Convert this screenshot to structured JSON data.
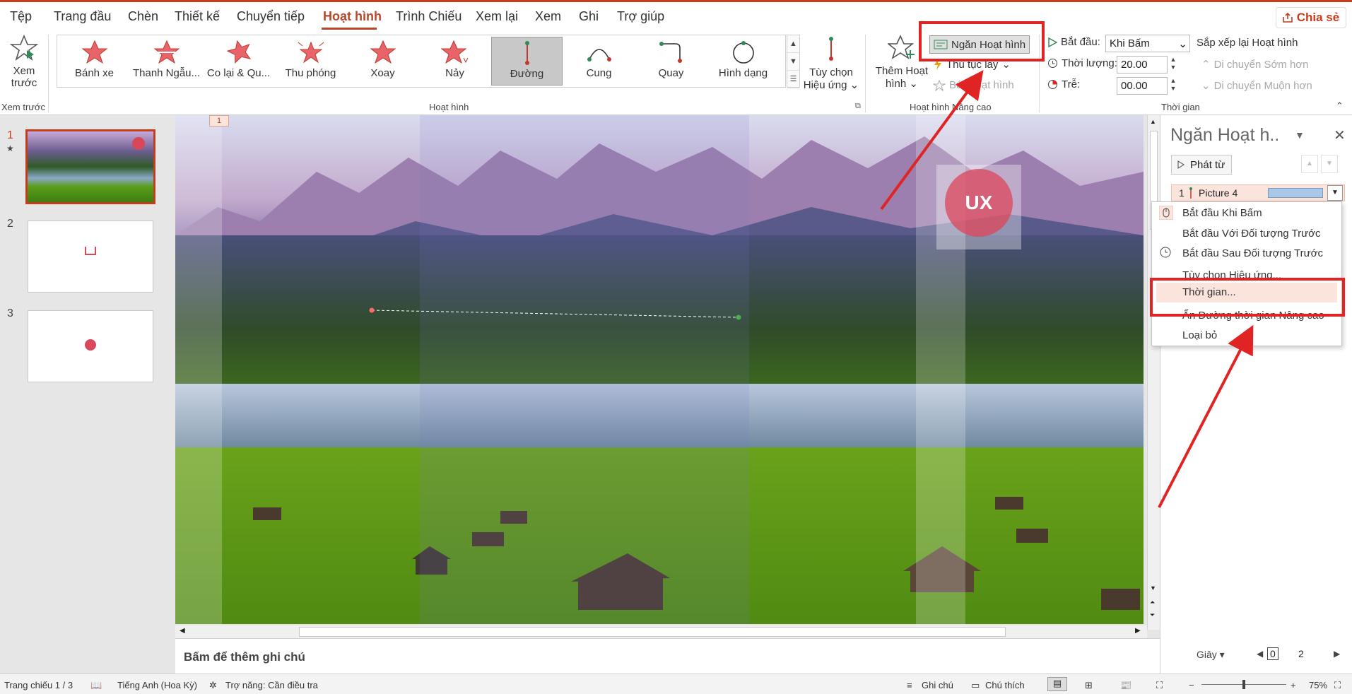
{
  "tabs": [
    "Tệp",
    "Trang đầu",
    "Chèn",
    "Thiết kế",
    "Chuyển tiếp",
    "Hoạt hình",
    "Trình Chiếu",
    "Xem lại",
    "Xem",
    "Ghi",
    "Trợ giúp"
  ],
  "share_label": "Chia sẻ",
  "ribbon": {
    "preview": {
      "label_line1": "Xem",
      "label_line2": "trước",
      "group_label": "Xem trước"
    },
    "gallery": {
      "items": [
        "Bánh xe",
        "Thanh Ngẫu...",
        "Co lại & Qu...",
        "Thu phóng",
        "Xoay",
        "Nảy",
        "Đường",
        "Cung",
        "Quay",
        "Hình dạng"
      ],
      "selected": "Đường",
      "group_label": "Hoạt hình"
    },
    "effect_options": {
      "line1": "Tùy chọn",
      "line2": "Hiệu ứng"
    },
    "advanced": {
      "add_line1": "Thêm Hoạt",
      "add_line2": "hình",
      "pane_button": "Ngăn Hoạt hình",
      "trigger": "Thủ tục lẫy",
      "painter": "Bút Hoạt hình",
      "group_label": "Hoạt hình Nâng cao"
    },
    "timing": {
      "start_label": "Bắt đầu:",
      "start_value": "Khi Bấm",
      "duration_label": "Thời lượng:",
      "duration_value": "20.00",
      "delay_label": "Trễ:",
      "delay_value": "00.00",
      "reorder_title": "Sắp xếp lại Hoạt hình",
      "move_earlier": "Di chuyển Sớm hơn",
      "move_later": "Di chuyển Muộn hơn",
      "group_label": "Thời gian"
    }
  },
  "thumbnails": [
    "1",
    "2",
    "3"
  ],
  "slide_number_tag": "1",
  "slide_logo_text": "UX",
  "notes_placeholder": "Bấm để thêm ghi chú",
  "pane": {
    "title": "Ngăn Hoạt h..",
    "play_from": "Phát từ",
    "item_number": "1",
    "item_name": "Picture 4",
    "menu": [
      "Bắt đầu Khi Bấm",
      "Bắt đầu Với Đối tượng Trước",
      "Bắt đầu Sau Đối tượng Trước",
      "Tùy chọn Hiệu ứng...",
      "Thời gian...",
      "Ẩn Đường thời gian Nâng cao",
      "Loại bỏ"
    ],
    "footer_unit": "Giây",
    "footer_scale": [
      "0",
      "2"
    ]
  },
  "status": {
    "slide": "Trang chiếu 1 / 3",
    "language": "Tiếng Anh (Hoa Kỳ)",
    "accessibility": "Trợ năng: Cần điều tra",
    "notes": "Ghi chú",
    "comments": "Chú thích",
    "zoom": "75%"
  },
  "colors": {
    "accent": "#b7472a",
    "annotation": "#e02424",
    "highlight": "#fbe4dc"
  }
}
